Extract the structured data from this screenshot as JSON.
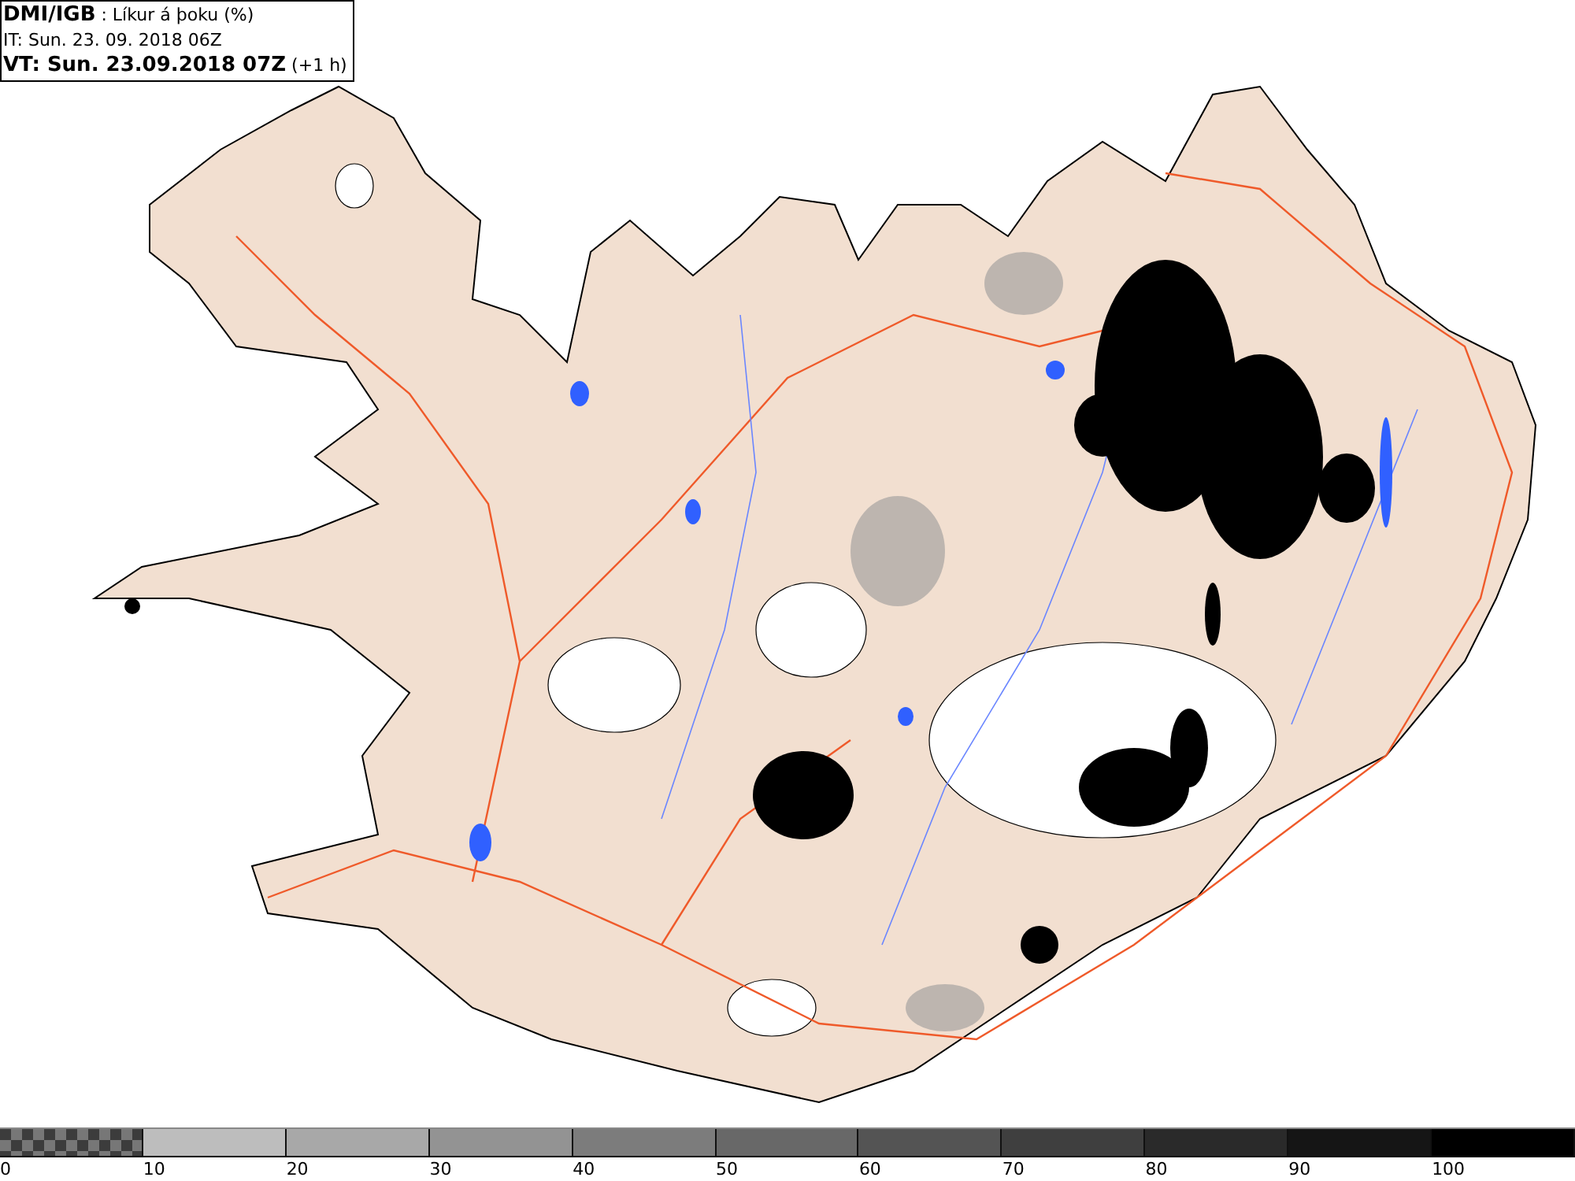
{
  "header": {
    "title": "**DMI/IGB** : Líkur á þoku (%)",
    "issue_time": "IT: Sun. 23. 09. 2018 06Z",
    "valid_time": "**VT: Sun. 23.09.2018 07Z** (+1 h)"
  },
  "legend": [
    {
      "label": "0",
      "kind": "checkered",
      "color": "#3c3c3c"
    },
    {
      "label": "10",
      "kind": "solid",
      "color": "#bdbdbd"
    },
    {
      "label": "20",
      "kind": "solid",
      "color": "#a8a8a8"
    },
    {
      "label": "30",
      "kind": "solid",
      "color": "#939393"
    },
    {
      "label": "40",
      "kind": "solid",
      "color": "#7c7c7c"
    },
    {
      "label": "50",
      "kind": "solid",
      "color": "#686868"
    },
    {
      "label": "60",
      "kind": "solid",
      "color": "#545454"
    },
    {
      "label": "70",
      "kind": "solid",
      "color": "#3f3f3f"
    },
    {
      "label": "80",
      "kind": "solid",
      "color": "#2a2a2a"
    },
    {
      "label": "90",
      "kind": "solid",
      "color": "#151515"
    },
    {
      "label": "100",
      "kind": "solid",
      "color": "#000000"
    }
  ]
}
